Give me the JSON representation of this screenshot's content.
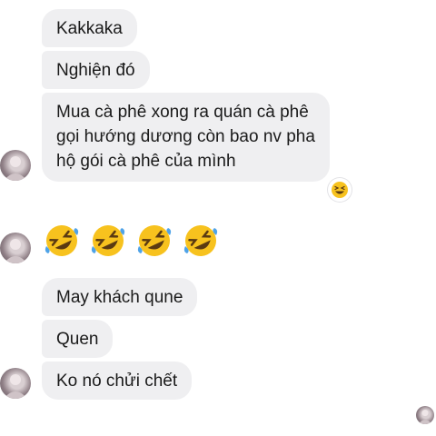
{
  "messages": [
    {
      "text": "Kakkaka"
    },
    {
      "text": "Nghiện đó"
    },
    {
      "lines": [
        "Mua cà phê xong ra quán cà phê",
        "gọi hướng dương còn bao nv pha",
        "hộ gói cà phê của mình"
      ]
    },
    {
      "emoji": [
        "rolling-on-floor-laughing",
        "rolling-on-floor-laughing",
        "rolling-on-floor-laughing",
        "rolling-on-floor-laughing"
      ]
    },
    {
      "text": "May khách qune"
    },
    {
      "text": "Quen"
    },
    {
      "text": "Ko nó chửi chết"
    }
  ],
  "reaction": {
    "icon": "grinning-squinting-face"
  },
  "colors": {
    "bubble": "#efeff1",
    "emoji": "#f7c21e",
    "tears": "#4fa3e8"
  }
}
